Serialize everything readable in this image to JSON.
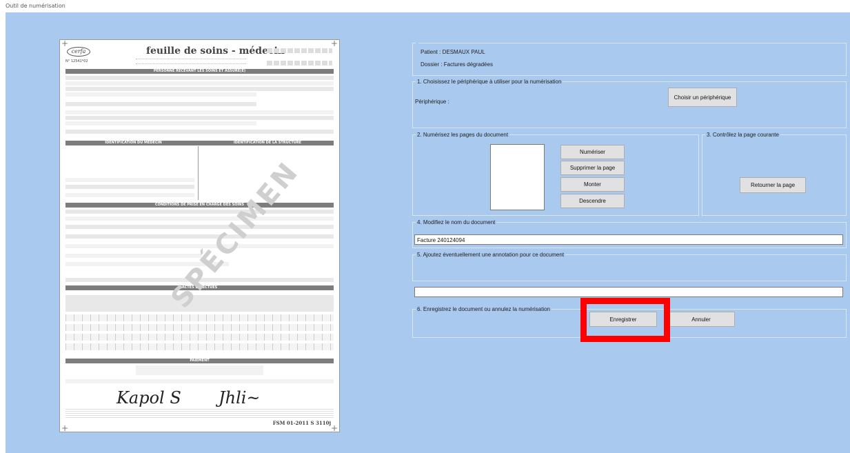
{
  "window": {
    "title": "Outil de numérisation"
  },
  "preview": {
    "logo": "cerfa",
    "code": "N° 12541*02",
    "title": "feuille de soins - médecin",
    "band_person": "PERSONNE RECEVANT LES SOINS ET ASSURÉ(E)",
    "band_ident_medecin": "IDENTIFICATION DU MÉDECIN",
    "band_ident_structure": "IDENTIFICATION DE LA STRUCTURE",
    "band_conditions": "CONDITIONS DE PRISE EN CHARGE DES SOINS",
    "band_actes": "ACTES EFFECTUÉS",
    "band_paiement": "PAIEMENT",
    "watermark": "SPÉCIMEN",
    "footer": "FSM 01-2011   S 3110j"
  },
  "patient": {
    "patient_line": "Patient : DESMAUX PAUL",
    "dossier_line": "Dossier : Factures dégradées"
  },
  "step1": {
    "legend": "1. Choisissez le périphérique à utiliser pour la numérisation",
    "device_label": "Périphérique :",
    "choose_button": "Choisir un périphérique"
  },
  "step2": {
    "legend": "2. Numérisez les pages du document",
    "scan_button": "Numériser",
    "delete_button": "Supprimer la page",
    "up_button": "Monter",
    "down_button": "Descendre"
  },
  "step3": {
    "legend": "3. Contrôlez la page courante",
    "rotate_button": "Retourner la page"
  },
  "step4": {
    "legend": "4. Modifiez le nom du document",
    "document_name": "Facture 240124094"
  },
  "step5": {
    "legend": "5. Ajoutez éventuellement une annotation pour ce document",
    "annotation": ""
  },
  "step6": {
    "legend": "6. Enregistrez le document ou annulez la numérisation",
    "save_button": "Enregistrer",
    "cancel_button": "Annuler"
  },
  "colors": {
    "background": "#a9c9ee",
    "highlight": "#ff0000",
    "button": "#e1e1e1"
  }
}
